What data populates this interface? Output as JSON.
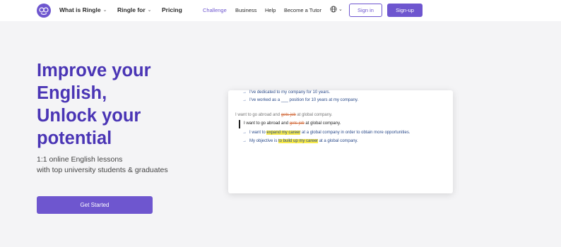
{
  "nav": {
    "what_is": "What is Ringle",
    "ringle_for": "Ringle for",
    "pricing": "Pricing",
    "challenge": "Challenge",
    "business": "Business",
    "help": "Help",
    "become_tutor": "Become a Tutor",
    "sign_in": "Sign in",
    "sign_up": "Sign-up"
  },
  "hero": {
    "title_1": "Improve your",
    "title_2": "English,",
    "title_3": "Unlock your",
    "title_4": "potential",
    "sub_1": "1:1 online English lessons",
    "sub_2": "with top university students & graduates",
    "cta": "Get Started"
  },
  "card": {
    "s1": "I've dedicated to my company for 10 years.",
    "s2": "I've worked as a ___ position for 10 years at my company.",
    "orig_pre": "I want to go abroad and ",
    "orig_strike": "gets job",
    "orig_post": " at global company.",
    "edit_pre": "I want to go abroad and ",
    "edit_strike": "gets job",
    "edit_post": " at global company.",
    "s3_pre": "I want to ",
    "s3_hl": "expand my career",
    "s3_post": " at a global company in order to obtain more opportunities.",
    "s4_pre": "My objective is ",
    "s4_hl": "to build up my career",
    "s4_post": " at a global company."
  },
  "colors": {
    "brand": "#6e56cf",
    "title": "#4a35b5",
    "highlight": "#f6e94a"
  },
  "icons": [
    "logo-icon",
    "chevron-down-icon",
    "globe-icon",
    "arrow-right-icon"
  ]
}
